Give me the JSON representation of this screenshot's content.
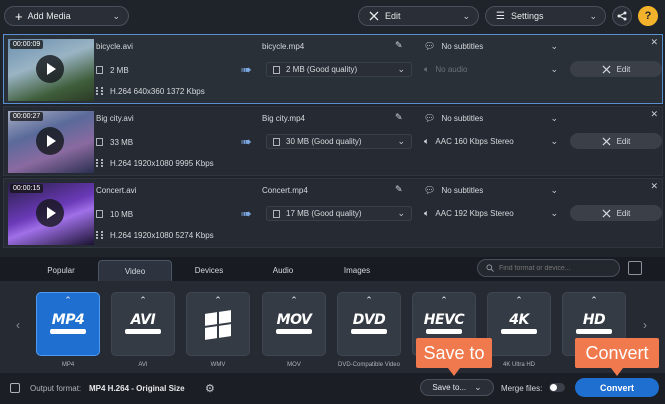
{
  "toolbar": {
    "add_media_label": "Add Media",
    "edit_label": "Edit",
    "settings_label": "Settings",
    "help_label": "?"
  },
  "files": [
    {
      "timecode": "00:00:09",
      "source_name": "bicycle.avi",
      "source_size": "2 MB",
      "source_info": "H.264 640x360 1372 Kbps",
      "output_name": "bicycle.mp4",
      "output_size": "2 MB (Good quality)",
      "subtitles": "No subtitles",
      "audio": "No audio",
      "edit_label": "Edit"
    },
    {
      "timecode": "00:00:27",
      "source_name": "Big city.avi",
      "source_size": "33 MB",
      "source_info": "H.264 1920x1080 9995 Kbps",
      "output_name": "Big city.mp4",
      "output_size": "30 MB (Good quality)",
      "subtitles": "No subtitles",
      "audio": "AAC 160 Kbps Stereo",
      "edit_label": "Edit"
    },
    {
      "timecode": "00:00:15",
      "source_name": "Concert.avi",
      "source_size": "10 MB",
      "source_info": "H.264 1920x1080 5274 Kbps",
      "output_name": "Concert.mp4",
      "output_size": "17 MB (Good quality)",
      "subtitles": "No subtitles",
      "audio": "AAC 192 Kbps Stereo",
      "edit_label": "Edit"
    }
  ],
  "tabs": [
    "Popular",
    "Video",
    "Devices",
    "Audio",
    "Images"
  ],
  "active_tab": "Video",
  "search": {
    "placeholder": "Find format or device..."
  },
  "formats": [
    {
      "logo": "MP4",
      "label": "MP4",
      "selected": true
    },
    {
      "logo": "AVI",
      "label": "AVI"
    },
    {
      "logo": "WMV",
      "label": "WMV"
    },
    {
      "logo": "MOV",
      "label": "MOV"
    },
    {
      "logo": "DVD",
      "label": "DVD-Compatible Video"
    },
    {
      "logo": "HEVC",
      "label": "HEVC"
    },
    {
      "logo": "4K",
      "label": "4K Ultra HD"
    },
    {
      "logo": "HD",
      "label": "HD"
    }
  ],
  "bottom": {
    "output_format_label": "Output format:",
    "output_format_value": "MP4 H.264 - Original Size",
    "save_to_label": "Save to...",
    "merge_files_label": "Merge files:",
    "convert_label": "Convert"
  },
  "callouts": {
    "save_to": "Save to",
    "convert": "Convert"
  },
  "colors": {
    "accent": "#1f6fd0",
    "callout": "#f07a4e",
    "background": "#1f232a"
  }
}
